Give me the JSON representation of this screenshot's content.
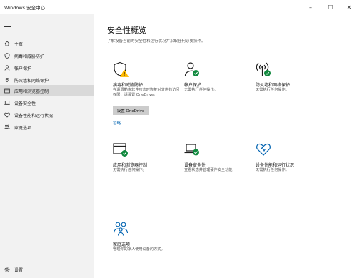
{
  "window": {
    "title": "Windows 安全中心"
  },
  "sidebar": {
    "items": [
      {
        "label": "主页",
        "icon": "home-icon"
      },
      {
        "label": "病毒和威胁防护",
        "icon": "shield-icon"
      },
      {
        "label": "帐户保护",
        "icon": "person-icon"
      },
      {
        "label": "防火墙和网络保护",
        "icon": "wifi-icon"
      },
      {
        "label": "应用和浏览器控制",
        "icon": "browser-icon",
        "selected": true
      },
      {
        "label": "设备安全性",
        "icon": "laptop-icon"
      },
      {
        "label": "设备性能和运行状况",
        "icon": "heart-icon"
      },
      {
        "label": "家庭选项",
        "icon": "family-icon"
      }
    ],
    "settings_label": "设置"
  },
  "main": {
    "title": "安全性概览",
    "subtitle": "了解设备当前的安全性和运行状况并采取任何必要操作。",
    "tiles": [
      {
        "title": "病毒和威胁防护",
        "desc": "在遭遇勒索软件攻击时恢复对文件的访问权限，请设置 OneDrive。",
        "button": "设置 OneDrive",
        "link": "忽略",
        "status": "warning"
      },
      {
        "title": "帐户保护",
        "desc": "无需执行任何操作。",
        "status": "ok"
      },
      {
        "title": "防火墙和网络保护",
        "desc": "无需执行任何操作。",
        "status": "ok"
      },
      {
        "title": "应用和浏览器控制",
        "desc": "无需执行任何操作。",
        "status": "ok"
      },
      {
        "title": "设备安全性",
        "desc": "查看状态并管理硬件安全功能",
        "status": "none"
      },
      {
        "title": "设备性能和运行状况",
        "desc": "无需执行任何操作。",
        "status": "ok"
      },
      {
        "title": "家庭选项",
        "desc": "管理你的家人使用设备的方式。",
        "status": "none"
      }
    ]
  },
  "colors": {
    "accent": "#0063b1",
    "ok": "#10893e",
    "warning": "#ffb900"
  }
}
